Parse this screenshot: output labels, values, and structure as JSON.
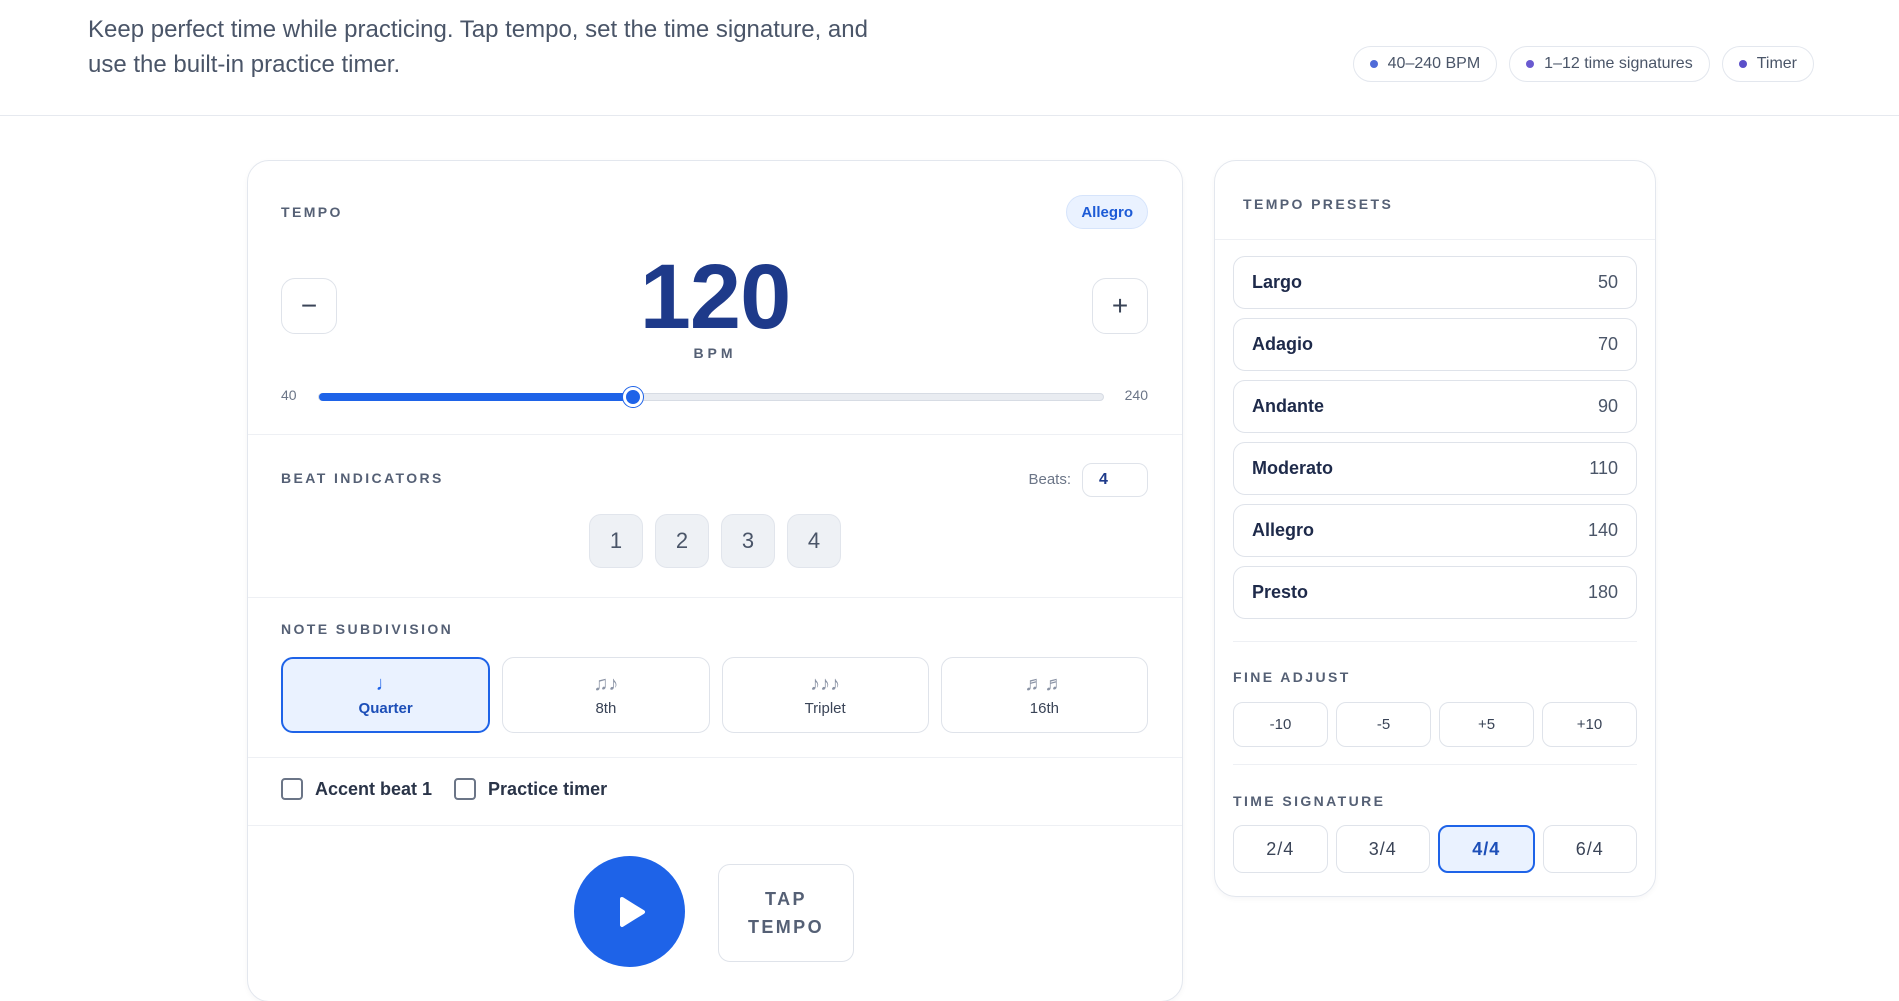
{
  "header": {
    "intro": "Keep perfect time while practicing. Tap tempo, set the time signature, and use the built-in practice timer.",
    "chips": [
      "40–240 BPM",
      "1–12 time signatures",
      "Timer"
    ]
  },
  "tempo": {
    "label": "TEMPO",
    "marking": "Allegro",
    "decrement": "−",
    "increment": "+",
    "value": "120",
    "unit": "BPM",
    "min": "40",
    "max": "240",
    "current": 120
  },
  "beats": {
    "label": "BEAT INDICATORS",
    "count_label": "Beats:",
    "count": "4",
    "items": [
      "1",
      "2",
      "3",
      "4"
    ]
  },
  "subdivision": {
    "label": "NOTE SUBDIVISION",
    "options": [
      {
        "glyph": "♩",
        "name": "Quarter",
        "active": true
      },
      {
        "glyph": "♫♪",
        "name": "8th",
        "active": false
      },
      {
        "glyph": "♪♪♪",
        "name": "Triplet",
        "active": false
      },
      {
        "glyph": "♬♬",
        "name": "16th",
        "active": false
      }
    ]
  },
  "options": {
    "accent": "Accent beat 1",
    "timer": "Practice timer"
  },
  "controls": {
    "tap": "TAP\nTEMPO"
  },
  "presets": {
    "label": "TEMPO PRESETS",
    "items": [
      {
        "name": "Largo",
        "bpm": "50"
      },
      {
        "name": "Adagio",
        "bpm": "70"
      },
      {
        "name": "Andante",
        "bpm": "90"
      },
      {
        "name": "Moderato",
        "bpm": "110"
      },
      {
        "name": "Allegro",
        "bpm": "140"
      },
      {
        "name": "Presto",
        "bpm": "180"
      }
    ]
  },
  "fine_adjust": {
    "label": "FINE ADJUST",
    "buttons": [
      "-10",
      "-5",
      "+5",
      "+10"
    ]
  },
  "time_signature": {
    "label": "TIME SIGNATURE",
    "options": [
      "2/4",
      "3/4",
      "4/4",
      "6/4"
    ],
    "selected": "4/4"
  },
  "colors": {
    "accent": "#1e63e8",
    "tempo_value": "#1e3a8a"
  }
}
